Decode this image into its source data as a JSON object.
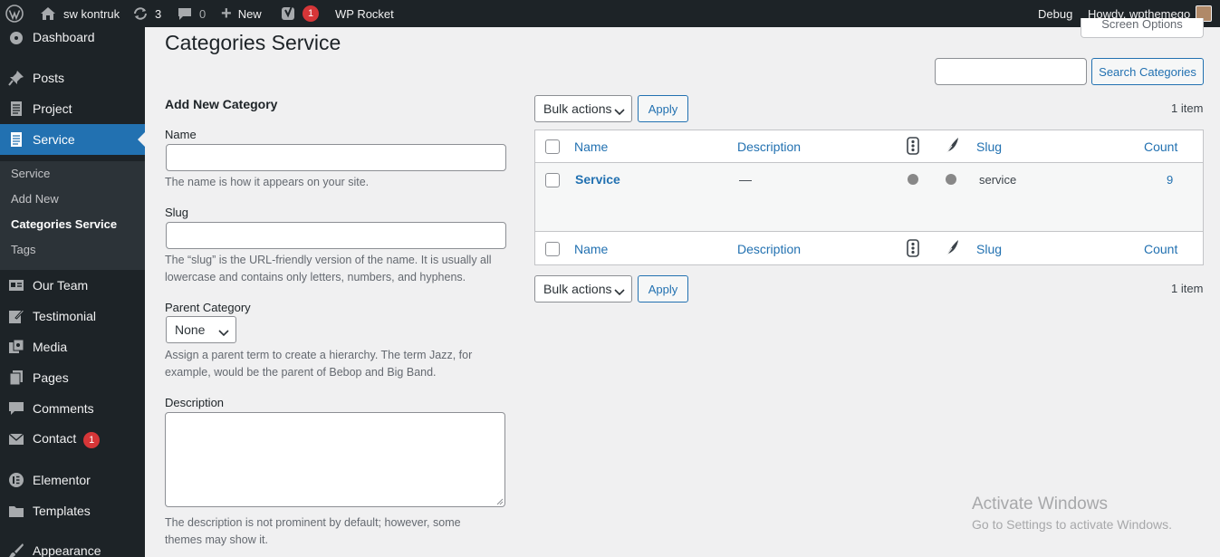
{
  "adminbar": {
    "site_name": "sw kontruk",
    "updates_count": "3",
    "comments_count": "0",
    "new_label": "New",
    "yoast_badge": "1",
    "wp_rocket": "WP Rocket",
    "debug": "Debug",
    "howdy": "Howdy, wpthemego"
  },
  "sidebar": {
    "items": [
      {
        "label": "Dashboard",
        "icon": "dashboard-icon"
      },
      {
        "label": "Posts",
        "icon": "pin-icon"
      },
      {
        "label": "Project",
        "icon": "page-icon"
      },
      {
        "label": "Service",
        "icon": "page-icon"
      },
      {
        "label": "Our Team",
        "icon": "id-card-icon"
      },
      {
        "label": "Testimonial",
        "icon": "edit-icon"
      },
      {
        "label": "Media",
        "icon": "media-icon"
      },
      {
        "label": "Pages",
        "icon": "pages-icon"
      },
      {
        "label": "Comments",
        "icon": "comment-icon"
      },
      {
        "label": "Contact",
        "icon": "mail-icon",
        "badge": "1"
      },
      {
        "label": "Elementor",
        "icon": "elementor-icon"
      },
      {
        "label": "Templates",
        "icon": "folder-icon"
      },
      {
        "label": "Appearance",
        "icon": "brush-icon"
      }
    ],
    "submenu": [
      "Service",
      "Add New",
      "Categories Service",
      "Tags"
    ]
  },
  "page": {
    "title": "Categories Service",
    "screen_options": "Screen Options"
  },
  "search": {
    "value": "",
    "button": "Search Categories"
  },
  "form": {
    "heading": "Add New Category",
    "name_label": "Name",
    "name_desc": "The name is how it appears on your site.",
    "slug_label": "Slug",
    "slug_desc_1": "The “slug” is the URL-friendly version of the name. It is usually all",
    "slug_desc_2": "lowercase and contains only letters, numbers, and hyphens.",
    "parent_label": "Parent Category",
    "parent_value": "None",
    "parent_desc_1": "Assign a parent term to create a hierarchy. The term Jazz, for",
    "parent_desc_2": "example, would be the parent of Bebop and Big Band.",
    "description_label": "Description",
    "description_desc_1": "The description is not prominent by default; however, some",
    "description_desc_2": "themes may show it."
  },
  "table": {
    "bulk_actions": "Bulk actions",
    "apply": "Apply",
    "item_count": "1 item",
    "columns": {
      "name": "Name",
      "description": "Description",
      "slug": "Slug",
      "count": "Count"
    },
    "rows": [
      {
        "name": "Service",
        "description": "—",
        "slug": "service",
        "count": "9"
      }
    ]
  },
  "watermark": {
    "line1": "Activate Windows",
    "line2": "Go to Settings to activate Windows."
  },
  "colors": {
    "adminbar_bg": "#1d2327",
    "accent": "#2271b1",
    "badge": "#d63638"
  }
}
